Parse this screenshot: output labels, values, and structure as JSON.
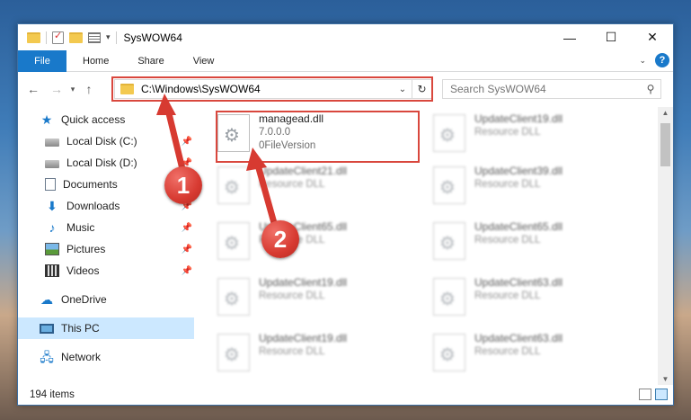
{
  "window": {
    "title": "SysWOW64",
    "controls": {
      "minimize": "—",
      "maximize": "☐",
      "close": "✕"
    }
  },
  "ribbon": {
    "file_tab": "File",
    "tabs": [
      "Home",
      "Share",
      "View"
    ],
    "help": "?"
  },
  "navigation": {
    "back": "←",
    "forward": "→",
    "recent": "▾",
    "up": "↑",
    "address_path": "C:\\Windows\\SysWOW64",
    "address_dropdown": "⌄",
    "refresh": "↻",
    "search_placeholder": "Search SysWOW64",
    "search_icon": "⚲"
  },
  "sidebar": {
    "items": [
      {
        "label": "Quick access",
        "icon": "star-icon",
        "pinned": false
      },
      {
        "label": "Local Disk (C:)",
        "icon": "disk-icon",
        "pinned": true
      },
      {
        "label": "Local Disk (D:)",
        "icon": "disk-icon",
        "pinned": true
      },
      {
        "label": "Documents",
        "icon": "documents-icon",
        "pinned": true
      },
      {
        "label": "Downloads",
        "icon": "download-icon",
        "pinned": true
      },
      {
        "label": "Music",
        "icon": "music-icon",
        "pinned": true
      },
      {
        "label": "Pictures",
        "icon": "pictures-icon",
        "pinned": true
      },
      {
        "label": "Videos",
        "icon": "videos-icon",
        "pinned": true
      },
      {
        "label": "OneDrive",
        "icon": "cloud-icon",
        "pinned": false
      },
      {
        "label": "This PC",
        "icon": "pc-icon",
        "pinned": false,
        "selected": true
      },
      {
        "label": "Network",
        "icon": "network-icon",
        "pinned": false
      }
    ]
  },
  "files": [
    {
      "name": "managead.dll",
      "line2": "7.0.0.0",
      "line3": "0FileVersion",
      "blurred": false
    },
    {
      "name": "UpdateClient19.dll",
      "line2": "Resource DLL",
      "blurred": true
    },
    {
      "name": "UpdateClient21.dll",
      "line2": "Resource DLL",
      "blurred": true
    },
    {
      "name": "UpdateClient39.dll",
      "line2": "Resource DLL",
      "blurred": true
    },
    {
      "name": "UpdateClient65.dll",
      "line2": "Resource DLL",
      "blurred": true
    },
    {
      "name": "UpdateClient65.dll",
      "line2": "Resource DLL",
      "blurred": true
    },
    {
      "name": "UpdateClient19.dll",
      "line2": "Resource DLL",
      "blurred": true
    },
    {
      "name": "UpdateClient63.dll",
      "line2": "Resource DLL",
      "blurred": true
    },
    {
      "name": "UpdateClient19.dll",
      "line2": "Resource DLL",
      "blurred": true
    },
    {
      "name": "UpdateClient63.dll",
      "line2": "Resource DLL",
      "blurred": true
    }
  ],
  "status": {
    "item_count": "194 items"
  },
  "callouts": [
    "1",
    "2"
  ],
  "colors": {
    "accent": "#1979ca",
    "highlight": "#d9473d",
    "selected_bg": "#cce8ff"
  }
}
